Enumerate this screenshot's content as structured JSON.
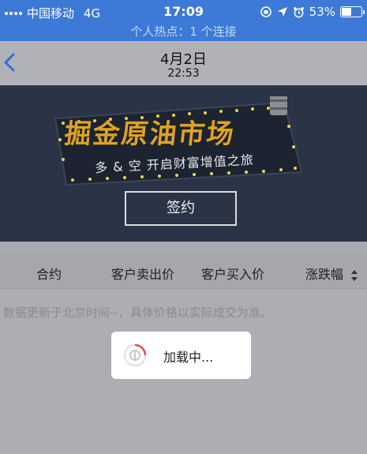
{
  "status_bar": {
    "carrier": "中国移动",
    "network": "4G",
    "time": "17:09",
    "battery": "53%",
    "battery_level": 0.53
  },
  "hotspot_banner": "个人热点：1 个连接",
  "nav": {
    "title": "4月2日",
    "subtitle": "22:53"
  },
  "banner": {
    "title": "掘金原油市场",
    "subtitle": "多 & 空  开启财富增值之旅",
    "button_label": "签约"
  },
  "table": {
    "columns": [
      "合约",
      "客户卖出价",
      "客户买入价",
      "涨跌幅"
    ]
  },
  "notice": "数据更新于北京时间--，具体价格以实际成交为准。",
  "loading_text": "加载中...",
  "colors": {
    "status_blue": "#3d79d6",
    "banner_bg": "#2a3446",
    "banner_gold": "#e0a31f"
  }
}
